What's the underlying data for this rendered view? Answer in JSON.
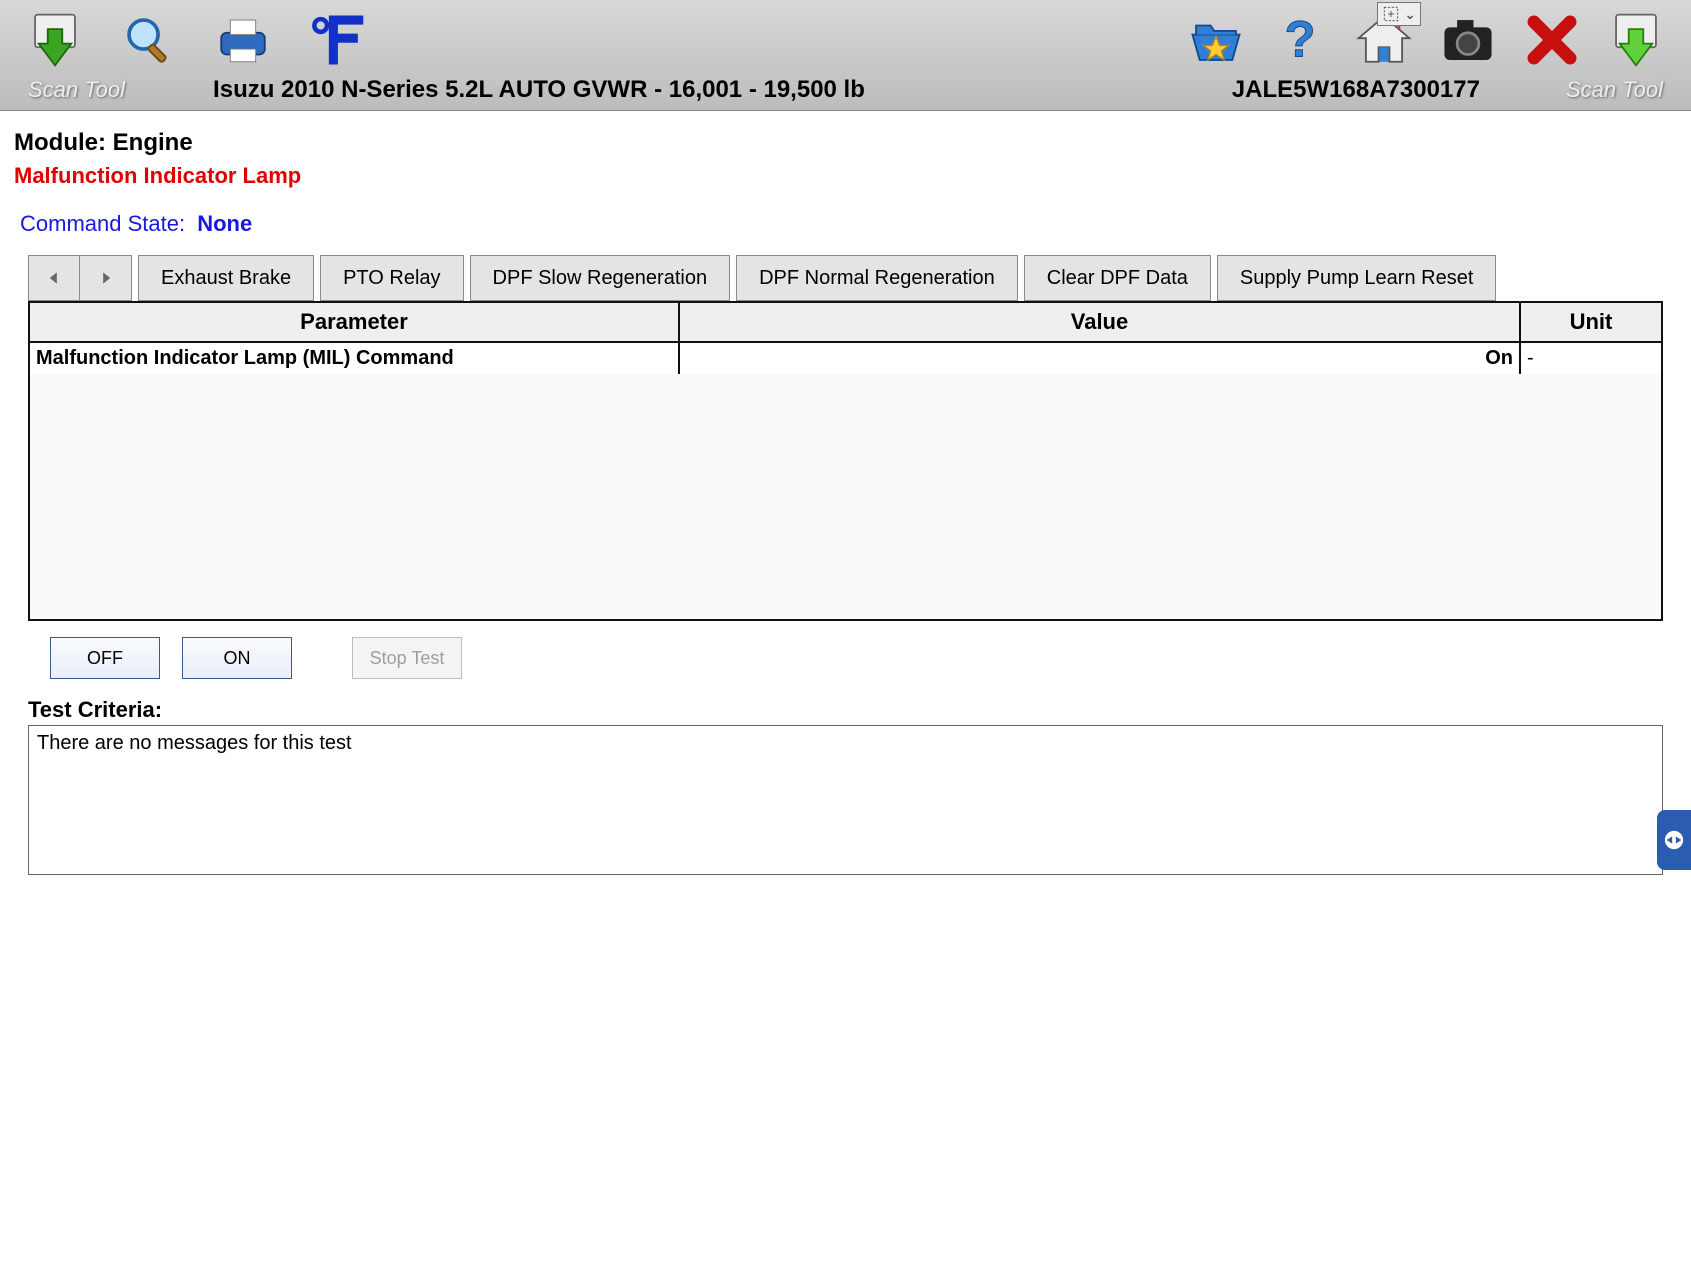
{
  "toolbar": {
    "scan_tool_label": "Scan Tool",
    "vehicle_description": "Isuzu  2010  N-Series  5.2L  AUTO GVWR - 16,001 - 19,500 lb",
    "vin": "JALE5W168A7300177"
  },
  "header": {
    "module_label": "Module:",
    "module_value": "Engine",
    "subtitle": "Malfunction Indicator Lamp",
    "command_state_label": "Command State:",
    "command_state_value": "None"
  },
  "tabs": [
    "Exhaust Brake",
    "PTO Relay",
    "DPF Slow Regeneration",
    "DPF Normal Regeneration",
    "Clear DPF Data",
    "Supply Pump Learn Reset"
  ],
  "table": {
    "columns": {
      "parameter": "Parameter",
      "value": "Value",
      "unit": "Unit"
    },
    "rows": [
      {
        "parameter": "Malfunction Indicator Lamp (MIL) Command",
        "value": "On",
        "unit": "-"
      }
    ]
  },
  "controls": {
    "off": "OFF",
    "on": "ON",
    "stop": "Stop Test"
  },
  "criteria": {
    "label": "Test Criteria:",
    "message": "There are no messages for this test"
  }
}
